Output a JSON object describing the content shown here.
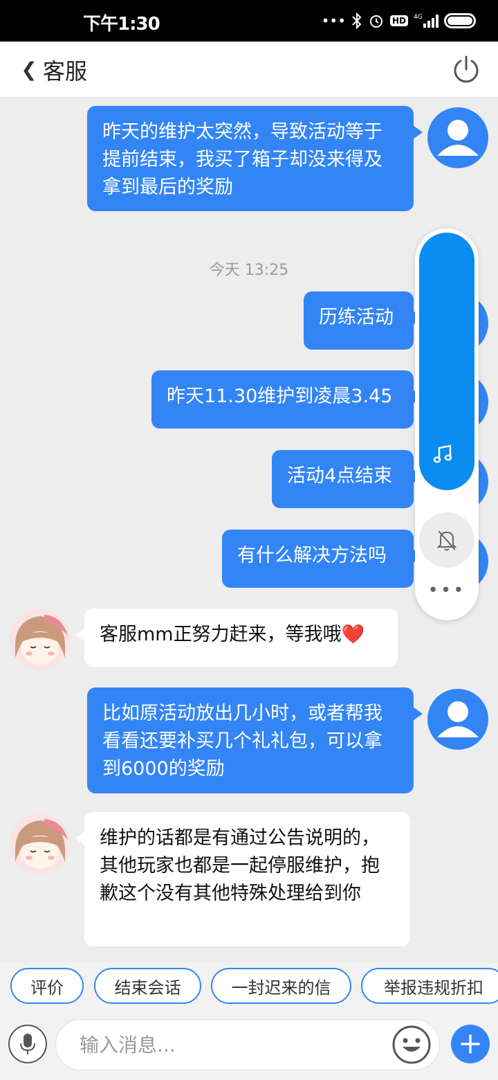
{
  "status_bar": {
    "time": "下午1:30",
    "network": "4G",
    "hd": "HD"
  },
  "header": {
    "back_glyph": "❮",
    "title": "客服"
  },
  "messages": [
    {
      "sender": "me",
      "text": "昨天的维护太突然，导致活动等于提前结束，我买了箱子却没来得及拿到最后的奖励"
    },
    {
      "type": "timestamp",
      "text": "今天 13:25"
    },
    {
      "sender": "me",
      "text": "历练活动"
    },
    {
      "sender": "me",
      "text": "昨天11.30维护到凌晨3.45"
    },
    {
      "sender": "me",
      "text": "活动4点结束"
    },
    {
      "sender": "me",
      "text": "有什么解决方法吗"
    },
    {
      "sender": "agent",
      "text": "客服mm正努力赶来，等我哦❤️"
    },
    {
      "sender": "me",
      "text": "比如原活动放出几小时，或者帮我看看还要补买几个礼礼包，可以拿到6000的奖励"
    },
    {
      "sender": "agent",
      "text": "维护的话都是有通过公告说明的，其他玩家也都是一起停服维护，抱歉这个没有其他特殊处理给到你"
    }
  ],
  "quick_replies": [
    "评价",
    "结束会话",
    "一封迟来的信",
    "举报违规折扣"
  ],
  "input": {
    "placeholder": "输入消息..."
  },
  "float_widget": {
    "more_glyph": "•••"
  },
  "colors": {
    "accent": "#3385f6",
    "widget_blue": "#0a8cf0"
  }
}
